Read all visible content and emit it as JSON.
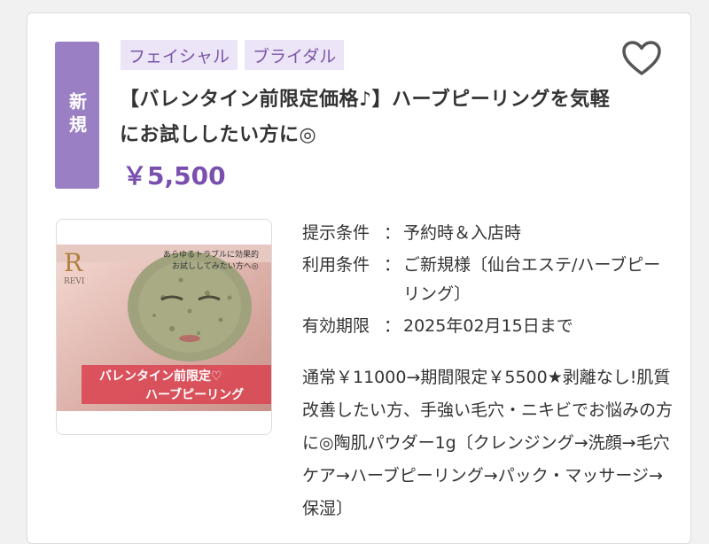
{
  "badge": {
    "label": "新規"
  },
  "tags": [
    "フェイシャル",
    "ブライダル"
  ],
  "favorite": {
    "icon": "heart-icon"
  },
  "title": "【バレンタイン前限定価格♪】ハーブピーリングを気軽にお試ししたい方に◎",
  "price": "￥5,500",
  "thumbnail": {
    "logo_text": "REVI",
    "caption_top_1": "あらゆるトラブルに効果的",
    "caption_top_2": "お試ししてみたい方へ◎",
    "banner_1": "バレンタイン前限定♡",
    "banner_2": "ハーブピーリング"
  },
  "conditions": [
    {
      "label": "提示条件",
      "colon": "：",
      "value": "予約時＆入店時"
    },
    {
      "label": "利用条件",
      "colon": "：",
      "value": "ご新規様〔仙台エステ/ハーブピーリング〕"
    },
    {
      "label": "有効期限",
      "colon": "：",
      "value": "2025年02月15日まで"
    }
  ],
  "description": "通常￥11000→期間限定￥5500★剥離なし!肌質改善したい方、手強い毛穴・ニキビでお悩みの方に◎陶肌パウダー1g〔クレンジング→洗顔→毛穴ケア→ハーブピーリング→パック・マッサージ→保湿〕",
  "colors": {
    "accent": "#7a4fae",
    "badge": "#9b7fc4",
    "tag_bg": "#ece4f7",
    "banner": "#d94a56"
  }
}
